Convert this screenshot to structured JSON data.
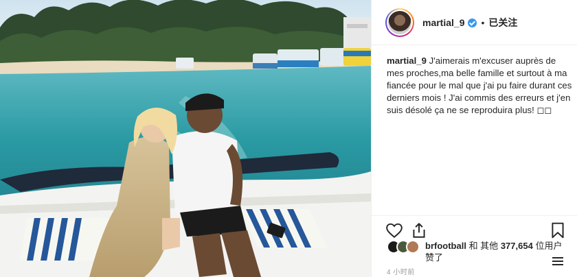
{
  "header": {
    "username": "martial_9",
    "separator": "•",
    "follow_label": "已关注"
  },
  "caption": {
    "username": "martial_9",
    "text": "J'aimerais m'excuser auprès de mes proches,ma belle famille et surtout à ma fiancée pour le mal que j'ai pu faire durant ces derniers mois ! J'ai commis des erreurs et j'en suis désolé ça ne se reproduira plus! ◻◻"
  },
  "icons": {
    "like": "heart-icon",
    "share": "share-icon",
    "save": "bookmark-icon",
    "verified": "verified-badge-icon"
  },
  "likes": {
    "first_user": "brfootball",
    "connector": "和 其他",
    "count": "377,654",
    "suffix": "位用户",
    "line2": "赞了"
  },
  "timestamp": "4 小时前",
  "colors": {
    "verified": "#3897f0",
    "border": "#efefef",
    "muted": "#999999",
    "text": "#262626"
  }
}
